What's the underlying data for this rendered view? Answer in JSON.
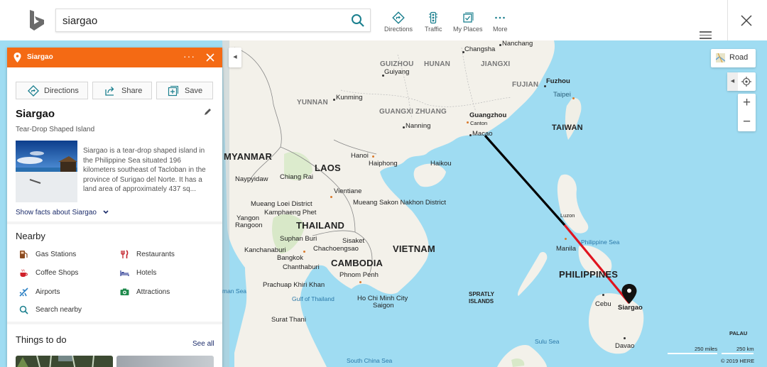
{
  "header": {
    "logo": "bing-logo",
    "search": {
      "value": "siargao",
      "placeholder": ""
    },
    "nav": [
      {
        "label": "Directions",
        "icon": "directions-icon"
      },
      {
        "label": "Traffic",
        "icon": "traffic-icon"
      },
      {
        "label": "My Places",
        "icon": "my-places-icon"
      },
      {
        "label": "More",
        "icon": "more-icon"
      }
    ]
  },
  "panel": {
    "header_title": "Siargao",
    "header_color": "#f46a14",
    "actions": {
      "directions": "Directions",
      "share": "Share",
      "save": "Save"
    },
    "place_title": "Siargao",
    "place_subtitle": "Tear-Drop Shaped Island",
    "description": "Siargao is a tear-drop shaped island in the Philippine Sea situated 196 kilometers southeast of Tacloban in the province of Surigao del Norte. It has a land area of approximately 437 sq...",
    "facts_link": "Show facts about Siargao",
    "nearby_title": "Nearby",
    "nearby": [
      {
        "label": "Gas Stations",
        "icon": "gas-station-icon"
      },
      {
        "label": "Restaurants",
        "icon": "restaurant-icon"
      },
      {
        "label": "Coffee Shops",
        "icon": "coffee-icon"
      },
      {
        "label": "Hotels",
        "icon": "hotel-icon"
      },
      {
        "label": "Airports",
        "icon": "airport-icon"
      },
      {
        "label": "Attractions",
        "icon": "attraction-icon"
      },
      {
        "label": "Search nearby",
        "icon": "search-icon"
      }
    ],
    "things_title": "Things to do",
    "see_all": "See all"
  },
  "map": {
    "style_button": "Road",
    "countries": [
      "MYANMAR",
      "LAOS",
      "THAILAND",
      "CAMBODIA",
      "VIETNAM",
      "TAIWAN",
      "PHILIPPINES"
    ],
    "provinces": [
      "YUNNAN",
      "GUIZHOU",
      "HUNAN",
      "JIANGXI",
      "FUJIAN",
      "GUANGXI ZHUANG"
    ],
    "cities": {
      "changsha": "Changsha",
      "nanchang": "Nanchang",
      "guiyang": "Guiyang",
      "kunming": "Kunming",
      "guangzhou": "Guangzhou",
      "canton": "Canton",
      "nanning": "Nanning",
      "macao": "Macao",
      "fuzhou": "Fuzhou",
      "taipei": "Taipei",
      "hanoi": "Hanoi",
      "haiphong": "Haiphong",
      "haikou": "Haikou",
      "naypyidaw": "Naypyidaw",
      "chiang_rai": "Chiang Rai",
      "vientiane": "Vientiane",
      "mueang_loei": "Mueang Loei District",
      "kamphaeng": "Kamphaeng Phet",
      "sakon": "Mueang Sakon Nakhon District",
      "yangon": "Yangon",
      "rangoon": "Rangoon",
      "suphan": "Suphan Buri",
      "sisaket": "Sisaket",
      "kanchanaburi": "Kanchanaburi",
      "chachoengsao": "Chachoengsao",
      "bangkok": "Bangkok",
      "chanthaburi": "Chanthaburi",
      "phnom_penh": "Phnom Penh",
      "prachuap": "Prachuap Khiri Khan",
      "hcmc": "Ho Chi Minh City",
      "saigon": "Saigon",
      "surat": "Surat Thani",
      "luzon": "Luzon",
      "manila": "Manila",
      "cebu": "Cebu",
      "siargao": "Siargao",
      "davao": "Davao"
    },
    "seas": {
      "andaman": "man Sea",
      "gulf_thailand": "Gulf of Thailand",
      "south_china": "South China Sea",
      "philippine": "Philippine Sea",
      "sulu": "Sulu Sea"
    },
    "spratly": [
      "SPRATLY",
      "ISLANDS"
    ],
    "palau": "PALAU",
    "scale": {
      "miles": "250 miles",
      "km": "250 km"
    },
    "copyright": "© 2019 HERE",
    "route_colors": {
      "segment1": "#000000",
      "segment2": "#e0141e"
    }
  }
}
